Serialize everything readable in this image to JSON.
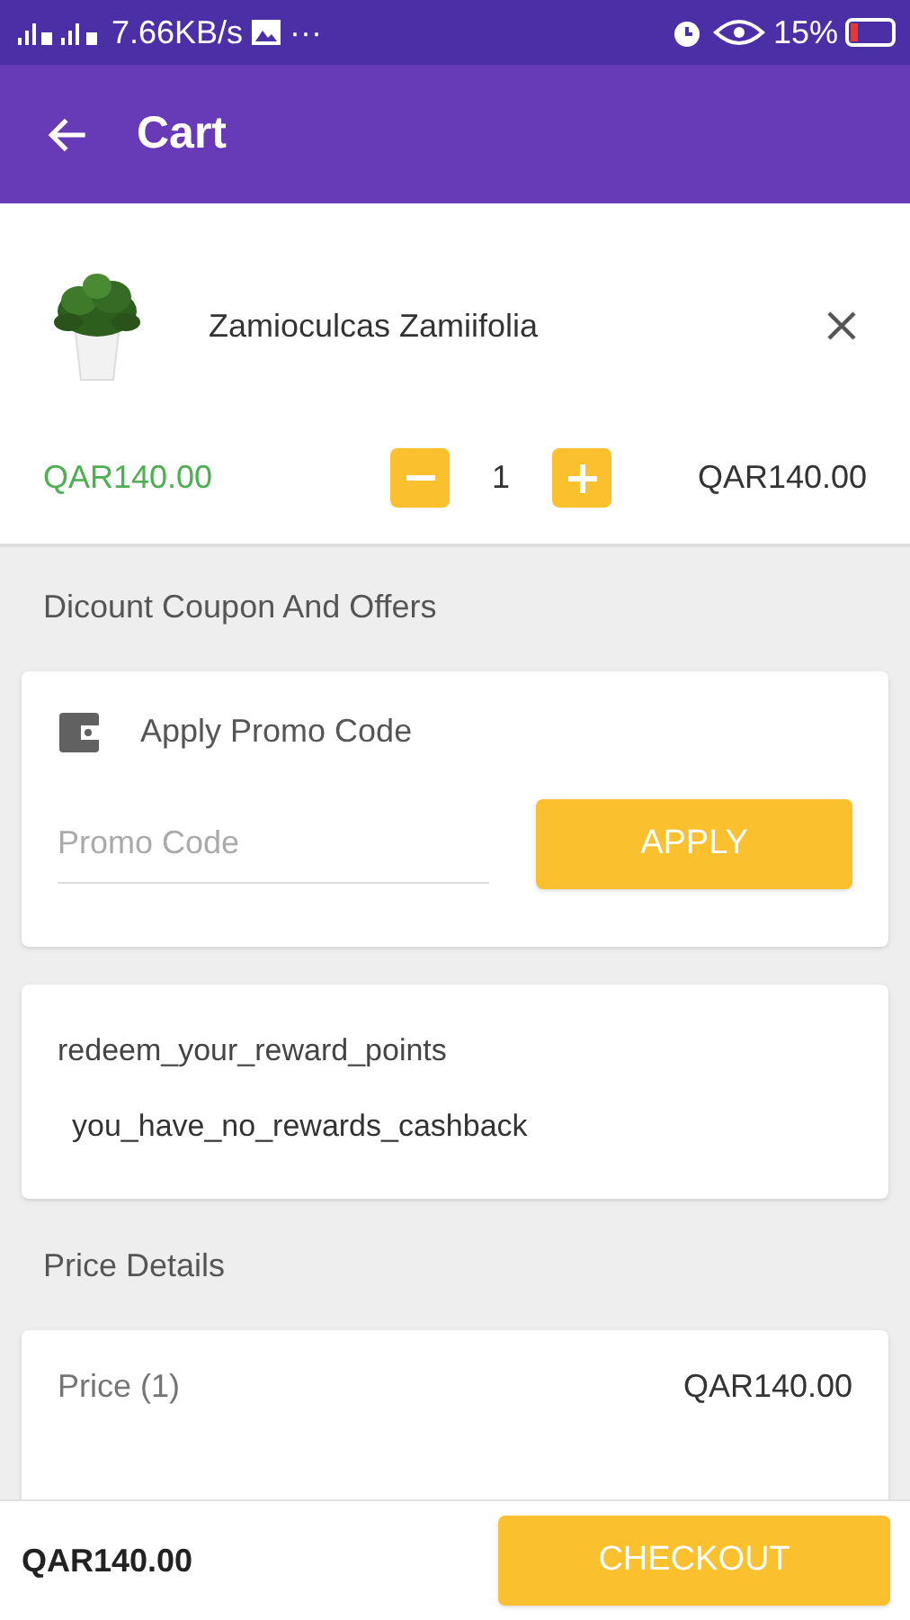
{
  "status_bar": {
    "speed": "7.66KB/s",
    "more": "···",
    "battery": "15%"
  },
  "app_bar": {
    "title": "Cart"
  },
  "cart_items": [
    {
      "name": "Zamioculcas Zamiifolia",
      "unit_price": "QAR140.00",
      "quantity": "1",
      "total": "QAR140.00"
    }
  ],
  "coupons": {
    "heading": "Dicount Coupon And Offers",
    "promo_title": "Apply Promo Code",
    "placeholder": "Promo Code",
    "apply_button": "APPLY"
  },
  "rewards": {
    "title": "redeem_your_reward_points",
    "message": "you_have_no_rewards_cashback"
  },
  "price_details": {
    "heading": "Price Details",
    "rows": [
      {
        "label": "Price (1)",
        "value": "QAR140.00"
      }
    ]
  },
  "bottom_bar": {
    "total": "QAR140.00",
    "checkout_button": "CHECKOUT"
  }
}
